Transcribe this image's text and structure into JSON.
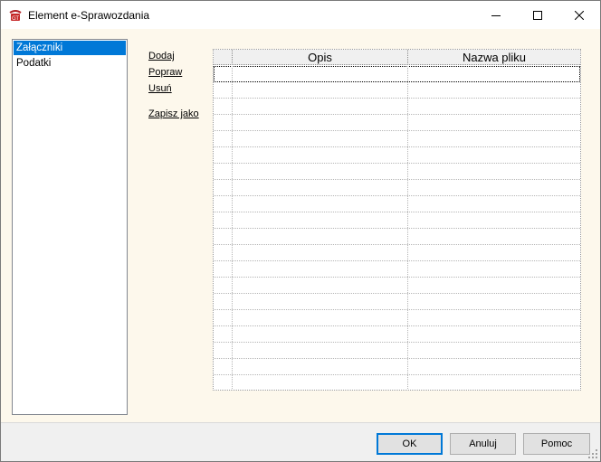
{
  "window": {
    "title": "Element e-Sprawozdania",
    "icon": "app-logo-icon",
    "controls": [
      "minimize-icon",
      "maximize-icon",
      "close-icon"
    ]
  },
  "tree": {
    "items": [
      {
        "label": "Załączniki",
        "selected": true
      },
      {
        "label": "Podatki",
        "selected": false
      }
    ]
  },
  "actions": {
    "add": "Dodaj",
    "edit": "Popraw",
    "delete": "Usuń",
    "save_as": "Zapisz jako"
  },
  "grid": {
    "columns": [
      "",
      "Opis",
      "Nazwa pliku"
    ],
    "rows": [
      [
        "",
        "",
        ""
      ],
      [
        "",
        "",
        ""
      ],
      [
        "",
        "",
        ""
      ],
      [
        "",
        "",
        ""
      ],
      [
        "",
        "",
        ""
      ],
      [
        "",
        "",
        ""
      ],
      [
        "",
        "",
        ""
      ],
      [
        "",
        "",
        ""
      ],
      [
        "",
        "",
        ""
      ],
      [
        "",
        "",
        ""
      ],
      [
        "",
        "",
        ""
      ],
      [
        "",
        "",
        ""
      ],
      [
        "",
        "",
        ""
      ],
      [
        "",
        "",
        ""
      ],
      [
        "",
        "",
        ""
      ],
      [
        "",
        "",
        ""
      ],
      [
        "",
        "",
        ""
      ],
      [
        "",
        "",
        ""
      ],
      [
        "",
        "",
        ""
      ],
      [
        "",
        "",
        ""
      ]
    ]
  },
  "buttons": {
    "ok": "OK",
    "cancel": "Anuluj",
    "help": "Pomoc"
  },
  "colors": {
    "selection": "#0078d7",
    "client_background": "#fdf8ec",
    "footer_background": "#f0f0f0"
  }
}
